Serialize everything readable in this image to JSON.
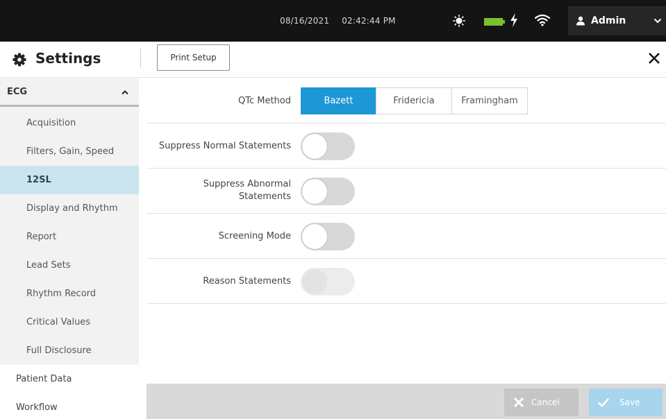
{
  "status_bar": {
    "date": "08/16/2021",
    "time": "02:42:44 PM",
    "icons": [
      "brightness-icon",
      "battery-icon",
      "charging-icon",
      "wifi-icon"
    ],
    "user_name": "Admin"
  },
  "header": {
    "title": "Settings",
    "print_setup_label": "Print Setup"
  },
  "sidebar": {
    "group_label": "ECG",
    "items": [
      {
        "label": "Acquisition"
      },
      {
        "label": "Filters, Gain, Speed"
      },
      {
        "label": "12SL",
        "active": true
      },
      {
        "label": "Display and Rhythm"
      },
      {
        "label": "Report"
      },
      {
        "label": "Lead Sets"
      },
      {
        "label": "Rhythm Record"
      },
      {
        "label": "Critical Values"
      },
      {
        "label": "Full Disclosure"
      }
    ],
    "top_items": [
      {
        "label": "Patient Data"
      },
      {
        "label": "Workflow"
      }
    ]
  },
  "settings": {
    "qtc_label": "QTc Method",
    "qtc_options": [
      "Bazett",
      "Fridericia",
      "Framingham"
    ],
    "qtc_selected": "Bazett",
    "suppress_normal_label": "Suppress Normal Statements",
    "suppress_normal_on": false,
    "suppress_abnormal_line1": "Suppress Abnormal",
    "suppress_abnormal_line2": "Statements",
    "suppress_abnormal_on": false,
    "screening_label": "Screening Mode",
    "screening_on": false,
    "reason_label": "Reason Statements",
    "reason_on": false,
    "reason_enabled": false
  },
  "footer": {
    "cancel_label": "Cancel",
    "save_label": "Save"
  },
  "colors": {
    "accent": "#1d97d6",
    "active_nav": "#cbe5ef",
    "battery": "#78c12f",
    "topbar": "#141414"
  }
}
